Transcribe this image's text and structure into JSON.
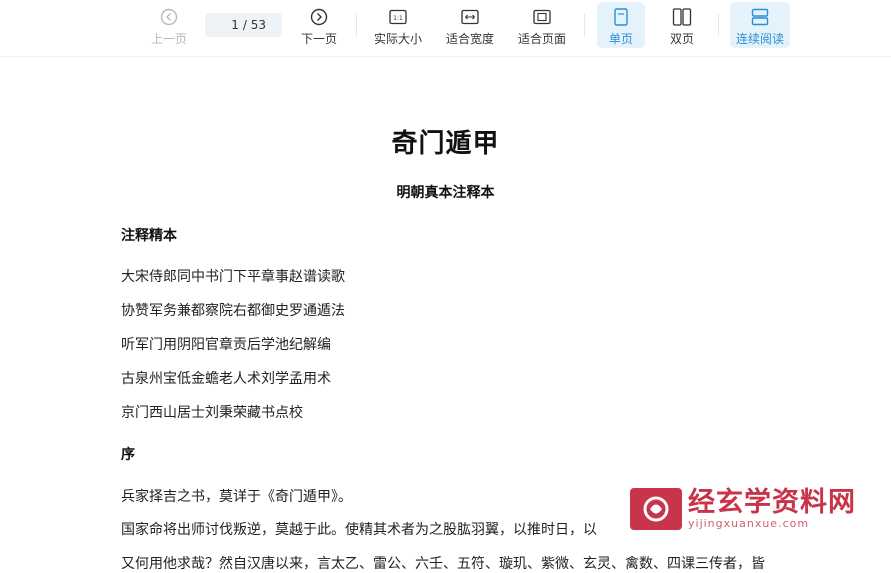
{
  "toolbar": {
    "prev_label": "上一页",
    "current_page": "1",
    "total_pages": "/ 53",
    "next_label": "下一页",
    "actual_size_label": "实际大小",
    "fit_width_label": "适合宽度",
    "fit_page_label": "适合页面",
    "single_page_label": "单页",
    "double_page_label": "双页",
    "continuous_label": "连续阅读",
    "accent_color": "#2a8fd6",
    "active_bg": "#e3f2fb"
  },
  "document": {
    "title": "奇门遁甲",
    "subtitle": "明朝真本注释本",
    "section1_heading": "注释精本",
    "credits": [
      "大宋侍郎同中书门下平章事赵谱读歌",
      "协赞军务兼都察院右都御史罗通遁法",
      "听军门用阴阳官章贡后学池纪解编",
      "古泉州宝低金蟾老人术刘学孟用术",
      "京门西山居士刘秉荣藏书点校"
    ],
    "section2_heading": "序",
    "preface": [
      "兵家择吉之书，莫详于《奇门遁甲》。",
      "国家命将出师讨伐叛逆，莫越于此。使精其术者为之股肱羽翼，以推时日，以",
      "又何用他求哉？然自汉唐以来，言太乙、雷公、六壬、五符、璇玑、紫微、玄灵、禽数、四课三传者，皆"
    ]
  },
  "watermark": {
    "name": "经玄学资料网",
    "url": "yijingxuanxue.com",
    "color": "#c8344a"
  }
}
